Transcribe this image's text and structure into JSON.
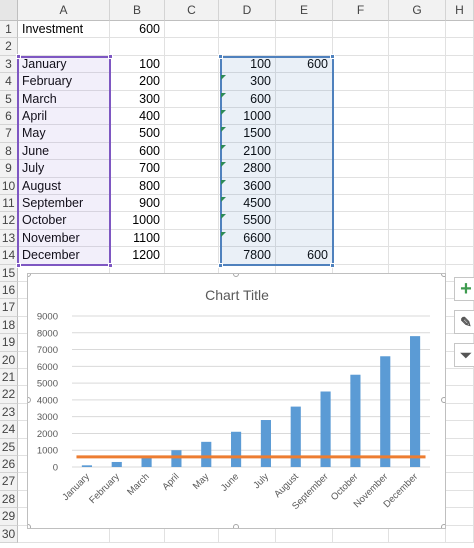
{
  "columns": [
    "A",
    "B",
    "C",
    "D",
    "E",
    "F",
    "G",
    "H"
  ],
  "rows": [
    "1",
    "2",
    "3",
    "4",
    "5",
    "6",
    "7",
    "8",
    "9",
    "10",
    "11",
    "12",
    "13",
    "14",
    "15",
    "16",
    "17",
    "18",
    "19",
    "20",
    "21",
    "22",
    "23",
    "24",
    "25",
    "26",
    "27",
    "28",
    "29",
    "30"
  ],
  "cells": {
    "A1": "Investment",
    "B1": "600",
    "A3": "January",
    "B3": "100",
    "D3": "100",
    "E3": "600",
    "A4": "February",
    "B4": "200",
    "D4": "300",
    "A5": "March",
    "B5": "300",
    "D5": "600",
    "A6": "April",
    "B6": "400",
    "D6": "1000",
    "A7": "May",
    "B7": "500",
    "D7": "1500",
    "A8": "June",
    "B8": "600",
    "D8": "2100",
    "A9": "July",
    "B9": "700",
    "D9": "2800",
    "A10": "August",
    "B10": "800",
    "D10": "3600",
    "A11": "September",
    "B11": "900",
    "D11": "4500",
    "A12": "October",
    "B12": "1000",
    "D12": "5500",
    "A13": "November",
    "B13": "1100",
    "D13": "6600",
    "A14": "December",
    "B14": "1200",
    "D14": "7800",
    "E14": "600"
  },
  "side_buttons": [
    {
      "name": "add-chart-element-icon",
      "glyph": "+"
    },
    {
      "name": "chart-styles-icon",
      "glyph": "✎"
    },
    {
      "name": "chart-filter-icon",
      "glyph": "⏷"
    }
  ],
  "colors": {
    "bar": "#5b9bd5",
    "line": "#ed7d31",
    "selectionA": "#7e57c2",
    "selectionD": "#4f81bd",
    "plus": "#3e9b4f"
  },
  "chart_data": {
    "type": "bar",
    "title": "Chart Title",
    "categories": [
      "January",
      "February",
      "March",
      "April",
      "May",
      "June",
      "July",
      "August",
      "September",
      "October",
      "November",
      "December"
    ],
    "series": [
      {
        "type": "bar",
        "values": [
          100,
          300,
          600,
          1000,
          1500,
          2100,
          2800,
          3600,
          4500,
          5500,
          6600,
          7800
        ]
      },
      {
        "type": "line",
        "values": [
          600,
          600,
          600,
          600,
          600,
          600,
          600,
          600,
          600,
          600,
          600,
          600
        ]
      }
    ],
    "ylim": [
      0,
      9000
    ],
    "yticks": [
      0,
      1000,
      2000,
      3000,
      4000,
      5000,
      6000,
      7000,
      8000,
      9000
    ],
    "grid": true,
    "xlabel": "",
    "ylabel": ""
  }
}
